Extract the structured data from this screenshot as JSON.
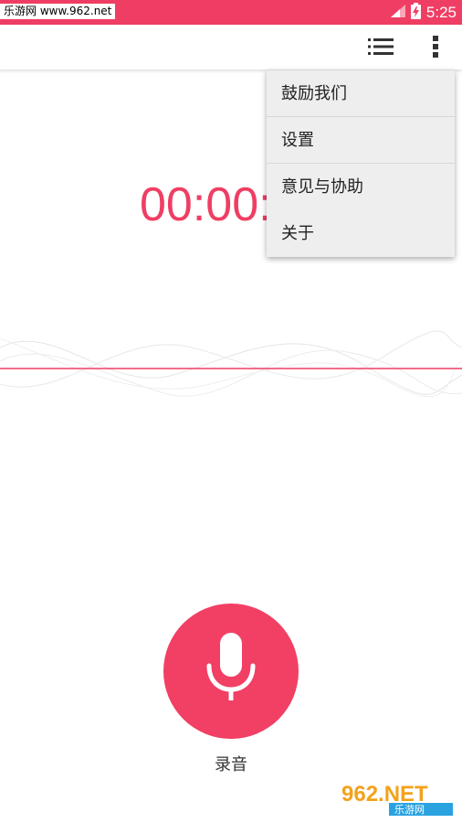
{
  "status_bar": {
    "watermark": "乐游网 www.962.net",
    "time": "5:25",
    "bg_color": "#ef3e63"
  },
  "toolbar": {
    "list_icon": "list-icon",
    "more_icon": "more-vert-icon"
  },
  "timer": {
    "text": "00:00:",
    "color": "#ef3e63"
  },
  "menu": {
    "items": [
      {
        "label": "鼓励我们"
      },
      {
        "label": "设置"
      },
      {
        "label": "意见与协助"
      },
      {
        "label": "关于"
      }
    ]
  },
  "record": {
    "label": "录音",
    "icon": "microphone-icon",
    "color": "#f23f64"
  },
  "logo": {
    "brand": "962.NET",
    "subtitle": "乐游网"
  }
}
